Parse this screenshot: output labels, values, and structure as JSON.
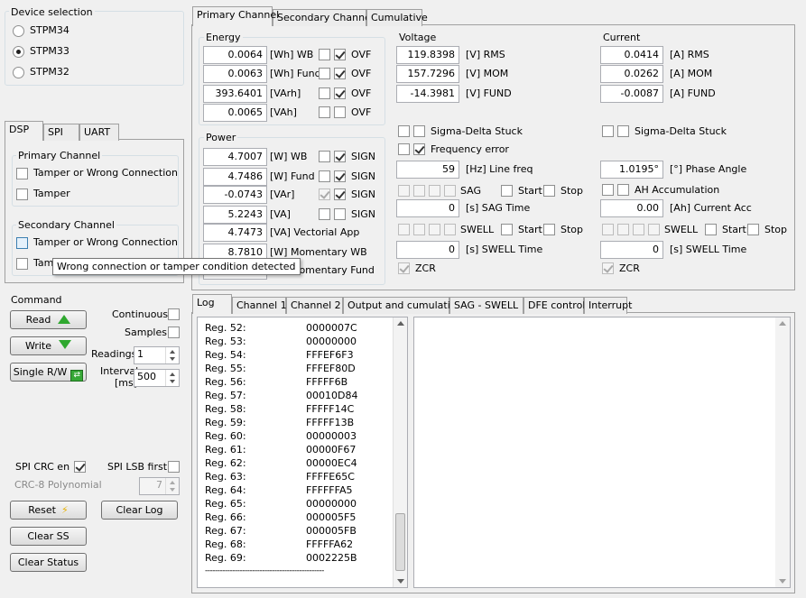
{
  "device_selection": {
    "title": "Device selection",
    "options": [
      "STPM34",
      "STPM33",
      "STPM32"
    ],
    "selected": "STPM33"
  },
  "left_tabs": [
    "DSP",
    "SPI",
    "UART"
  ],
  "dsp": {
    "primary_title": "Primary Channel",
    "primary_items": [
      "Tamper or Wrong Connection",
      "Tamper"
    ],
    "secondary_title": "Secondary Channel",
    "secondary_items": [
      "Tamper or Wrong Connection",
      "Tamper"
    ],
    "tooltip": "Wrong connection or tamper condition detected"
  },
  "command": {
    "title": "Command",
    "read": "Read",
    "write": "Write",
    "single_rw": "Single R/W",
    "continuous": "Continuous",
    "samples": "Samples",
    "readings_label": "Readings",
    "readings_value": "1",
    "interval_label1": "Interval",
    "interval_label2": "[ms]",
    "interval_value": "500"
  },
  "spi": {
    "crc_en": "SPI CRC en",
    "lsb_first": "SPI LSB first",
    "crc8_label": "CRC-8 Polynomial",
    "crc8_value": "7"
  },
  "buttons": {
    "reset": "Reset",
    "clear_log": "Clear Log",
    "clear_ss": "Clear SS",
    "clear_status": "Clear Status"
  },
  "main_tabs": [
    "Primary Channel",
    "Secondary Channel",
    "Cumulative"
  ],
  "energy": {
    "title": "Energy",
    "rows": [
      {
        "value": "0.0064",
        "unit": "[Wh] WB",
        "flag": "OVF"
      },
      {
        "value": "0.0063",
        "unit": "[Wh] Fund",
        "flag": "OVF"
      },
      {
        "value": "393.6401",
        "unit": "[VArh]",
        "flag": "OVF"
      },
      {
        "value": "0.0065",
        "unit": "[VAh]",
        "flag": "OVF"
      }
    ]
  },
  "power": {
    "title": "Power",
    "rows": [
      {
        "value": "4.7007",
        "unit": "[W] WB",
        "flag": "SIGN"
      },
      {
        "value": "4.7486",
        "unit": "[W] Fund",
        "flag": "SIGN"
      },
      {
        "value": "-0.0743",
        "unit": "[VAr]",
        "flag": "SIGN"
      },
      {
        "value": "5.2243",
        "unit": "[VA]",
        "flag": "SIGN"
      },
      {
        "value": "4.7473",
        "unit": "[VA] Vectorial App"
      },
      {
        "value": "8.7810",
        "unit": "[W] Momentary WB"
      },
      {
        "value": "",
        "unit": "[W] Momentary Fund"
      }
    ]
  },
  "voltage": {
    "title": "Voltage",
    "rows": [
      {
        "value": "119.8398",
        "unit": "[V] RMS"
      },
      {
        "value": "157.7296",
        "unit": "[V] MOM"
      },
      {
        "value": "-14.3981",
        "unit": "[V] FUND"
      }
    ],
    "sigma_delta": "Sigma-Delta Stuck",
    "freq_error": "Frequency error",
    "line_freq_value": "59",
    "line_freq_unit": "[Hz] Line freq",
    "sag": "SAG",
    "start": "Start",
    "stop": "Stop",
    "sag_time_value": "0",
    "sag_time_unit": "[s] SAG Time",
    "swell": "SWELL",
    "swell_time_value": "0",
    "swell_time_unit": "[s] SWELL Time",
    "zcr": "ZCR"
  },
  "current": {
    "title": "Current",
    "rows": [
      {
        "value": "0.0414",
        "unit": "[A] RMS"
      },
      {
        "value": "0.0262",
        "unit": "[A] MOM"
      },
      {
        "value": "-0.0087",
        "unit": "[A] FUND"
      }
    ],
    "sigma_delta": "Sigma-Delta Stuck",
    "phase_value": "1.0195°",
    "phase_unit": "[°] Phase Angle",
    "ah_acc": "AH Accumulation",
    "current_acc_value": "0.00",
    "current_acc_unit": "[Ah] Current Acc",
    "swell": "SWELL",
    "start": "Start",
    "stop": "Stop",
    "swell_time_value": "0",
    "swell_time_unit": "[s] SWELL Time",
    "zcr": "ZCR"
  },
  "log_tabs": [
    "Log",
    "Channel 1",
    "Channel 2",
    "Output and cumulative",
    "SAG - SWELL",
    "DFE control",
    "Interrupt"
  ],
  "log_rows": [
    [
      "Reg. 52:",
      "0000007C"
    ],
    [
      "Reg. 53:",
      "00000000"
    ],
    [
      "Reg. 54:",
      "FFFEF6F3"
    ],
    [
      "Reg. 55:",
      "FFFEF80D"
    ],
    [
      "Reg. 56:",
      "FFFFF6B"
    ],
    [
      "Reg. 57:",
      "00010D84"
    ],
    [
      "Reg. 58:",
      "FFFFF14C"
    ],
    [
      "Reg. 59:",
      "FFFFF13B"
    ],
    [
      "Reg. 60:",
      "00000003"
    ],
    [
      "Reg. 61:",
      "00000F67"
    ],
    [
      "Reg. 62:",
      "00000EC4"
    ],
    [
      "Reg. 63:",
      "FFFFE65C"
    ],
    [
      "Reg. 64:",
      "FFFFFFA5"
    ],
    [
      "Reg. 65:",
      "00000000"
    ],
    [
      "Reg. 66:",
      "000005F5"
    ],
    [
      "Reg. 67:",
      "000005FB"
    ],
    [
      "Reg. 68:",
      "FFFFFA62"
    ],
    [
      "Reg. 69:",
      "0002225B"
    ]
  ],
  "log_separator": "------------------------------------------------"
}
